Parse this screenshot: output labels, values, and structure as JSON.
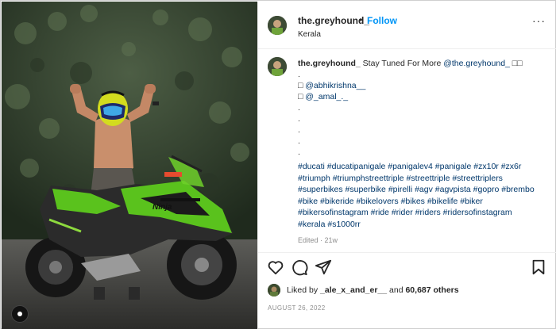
{
  "header": {
    "username": "the.greyhound_",
    "separator": "•",
    "follow_label": "Follow",
    "location": "Kerala",
    "more_label": "···"
  },
  "caption": {
    "username": "the.greyhound_",
    "text": " Stay Tuned For More ",
    "mention_main": "@the.greyhound_",
    "emoji_tail": " □□",
    "dot": ".",
    "credit_icon_1": "□",
    "credit_1": "@abhikrishna__",
    "credit_icon_2": "□",
    "credit_2": "@_amal_._",
    "hashtag_lines": [
      "#ducati #ducatipanigale #panigalev4 #panigale #zx10r #zx6r",
      "#triumph #triumphstreettriple #streettriple #streettriplers",
      "#superbikes #superbike #pirelli #agv #agvpista #gopro #brembo",
      "#bike #bikeride #bikelovers #bikes #bikelife #biker",
      "#bikersofinstagram #ride #rider #riders #ridersofinstagram",
      "#kerala #s1000rr"
    ],
    "edited": "Edited · 21w"
  },
  "likes": {
    "prefix": "Liked by ",
    "user": "_ale_x_and_er__",
    "middle": " and ",
    "count": "60,687 others"
  },
  "date": "AUGUST 26, 2022",
  "icons": {
    "like": "heart-icon",
    "comment": "comment-icon",
    "share": "paper-plane-icon",
    "save": "bookmark-icon",
    "media_indicator": "tag-indicator-icon"
  },
  "colors": {
    "link": "#0095f6",
    "mention": "#00376b",
    "muted": "#8e8e8e",
    "bike_green": "#5ac21d"
  }
}
